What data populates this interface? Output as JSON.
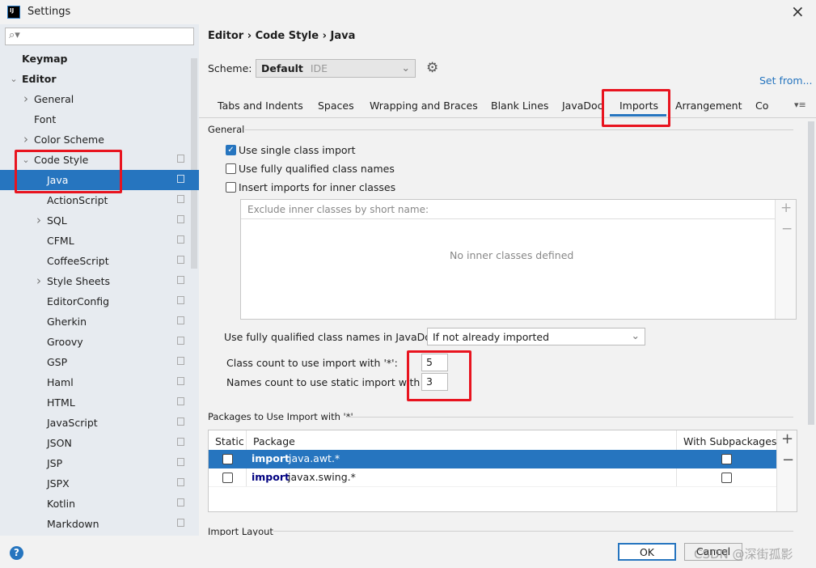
{
  "window": {
    "title": "Settings",
    "logo": "IJ",
    "close_icon": "×"
  },
  "sidebar": {
    "search_placeholder": "",
    "items": [
      {
        "label": "Keymap",
        "level": 0,
        "arrow": "",
        "bold": true
      },
      {
        "label": "Editor",
        "level": 0,
        "arrow": "down",
        "bold": true
      },
      {
        "label": "General",
        "level": 1,
        "arrow": "right"
      },
      {
        "label": "Font",
        "level": 1,
        "arrow": ""
      },
      {
        "label": "Color Scheme",
        "level": 1,
        "arrow": "right"
      },
      {
        "label": "Code Style",
        "level": 1,
        "arrow": "down",
        "copy": true
      },
      {
        "label": "Java",
        "level": 2,
        "arrow": "",
        "copy": true,
        "selected": true
      },
      {
        "label": "ActionScript",
        "level": 2,
        "arrow": "",
        "copy": true
      },
      {
        "label": "SQL",
        "level": 2,
        "arrow": "right",
        "copy": true
      },
      {
        "label": "CFML",
        "level": 2,
        "arrow": "",
        "copy": true
      },
      {
        "label": "CoffeeScript",
        "level": 2,
        "arrow": "",
        "copy": true
      },
      {
        "label": "Style Sheets",
        "level": 2,
        "arrow": "right",
        "copy": true
      },
      {
        "label": "EditorConfig",
        "level": 2,
        "arrow": "",
        "copy": true
      },
      {
        "label": "Gherkin",
        "level": 2,
        "arrow": "",
        "copy": true
      },
      {
        "label": "Groovy",
        "level": 2,
        "arrow": "",
        "copy": true
      },
      {
        "label": "GSP",
        "level": 2,
        "arrow": "",
        "copy": true
      },
      {
        "label": "Haml",
        "level": 2,
        "arrow": "",
        "copy": true
      },
      {
        "label": "HTML",
        "level": 2,
        "arrow": "",
        "copy": true
      },
      {
        "label": "JavaScript",
        "level": 2,
        "arrow": "",
        "copy": true
      },
      {
        "label": "JSON",
        "level": 2,
        "arrow": "",
        "copy": true
      },
      {
        "label": "JSP",
        "level": 2,
        "arrow": "",
        "copy": true
      },
      {
        "label": "JSPX",
        "level": 2,
        "arrow": "",
        "copy": true
      },
      {
        "label": "Kotlin",
        "level": 2,
        "arrow": "",
        "copy": true
      },
      {
        "label": "Markdown",
        "level": 2,
        "arrow": "",
        "copy": true
      }
    ]
  },
  "breadcrumb": [
    "Editor",
    "Code Style",
    "Java"
  ],
  "scheme": {
    "label": "Scheme:",
    "value": "Default",
    "sub": "IDE",
    "set_from": "Set from..."
  },
  "tabs": [
    "Tabs and Indents",
    "Spaces",
    "Wrapping and Braces",
    "Blank Lines",
    "JavaDoc",
    "Imports",
    "Arrangement",
    "Co"
  ],
  "active_tab": "Imports",
  "general": {
    "title": "General",
    "single_class_import": {
      "label": "Use single class import",
      "checked": true
    },
    "fully_qualified": {
      "label": "Use fully qualified class names",
      "checked": false
    },
    "inner_classes": {
      "label": "Insert imports for inner classes",
      "checked": false
    },
    "exclude_placeholder": "Exclude inner classes by short name:",
    "empty_text": "No inner classes defined",
    "javadoc_label": "Use fully qualified class names in JavaDoc:",
    "javadoc_value": "If not already imported",
    "class_count_label": "Class count to use import with '*':",
    "class_count": "5",
    "names_count_label": "Names count to use static import with '*':",
    "names_count": "3"
  },
  "packages": {
    "title": "Packages to Use Import with '*'",
    "columns": [
      "Static",
      "Package",
      "With Subpackages"
    ],
    "rows": [
      {
        "keyword": "import",
        "name": "java.awt.*",
        "static": false,
        "sub": false,
        "selected": true
      },
      {
        "keyword": "import",
        "name": "javax.swing.*",
        "static": false,
        "sub": false,
        "selected": false
      }
    ]
  },
  "import_layout": {
    "title": "Import Layout"
  },
  "footer": {
    "ok": "OK",
    "cancel": "Cancel",
    "help": "?",
    "watermark": "CSDN @深街孤影"
  },
  "colors": {
    "accent": "#2675bf",
    "annotation": "#e8141f"
  }
}
